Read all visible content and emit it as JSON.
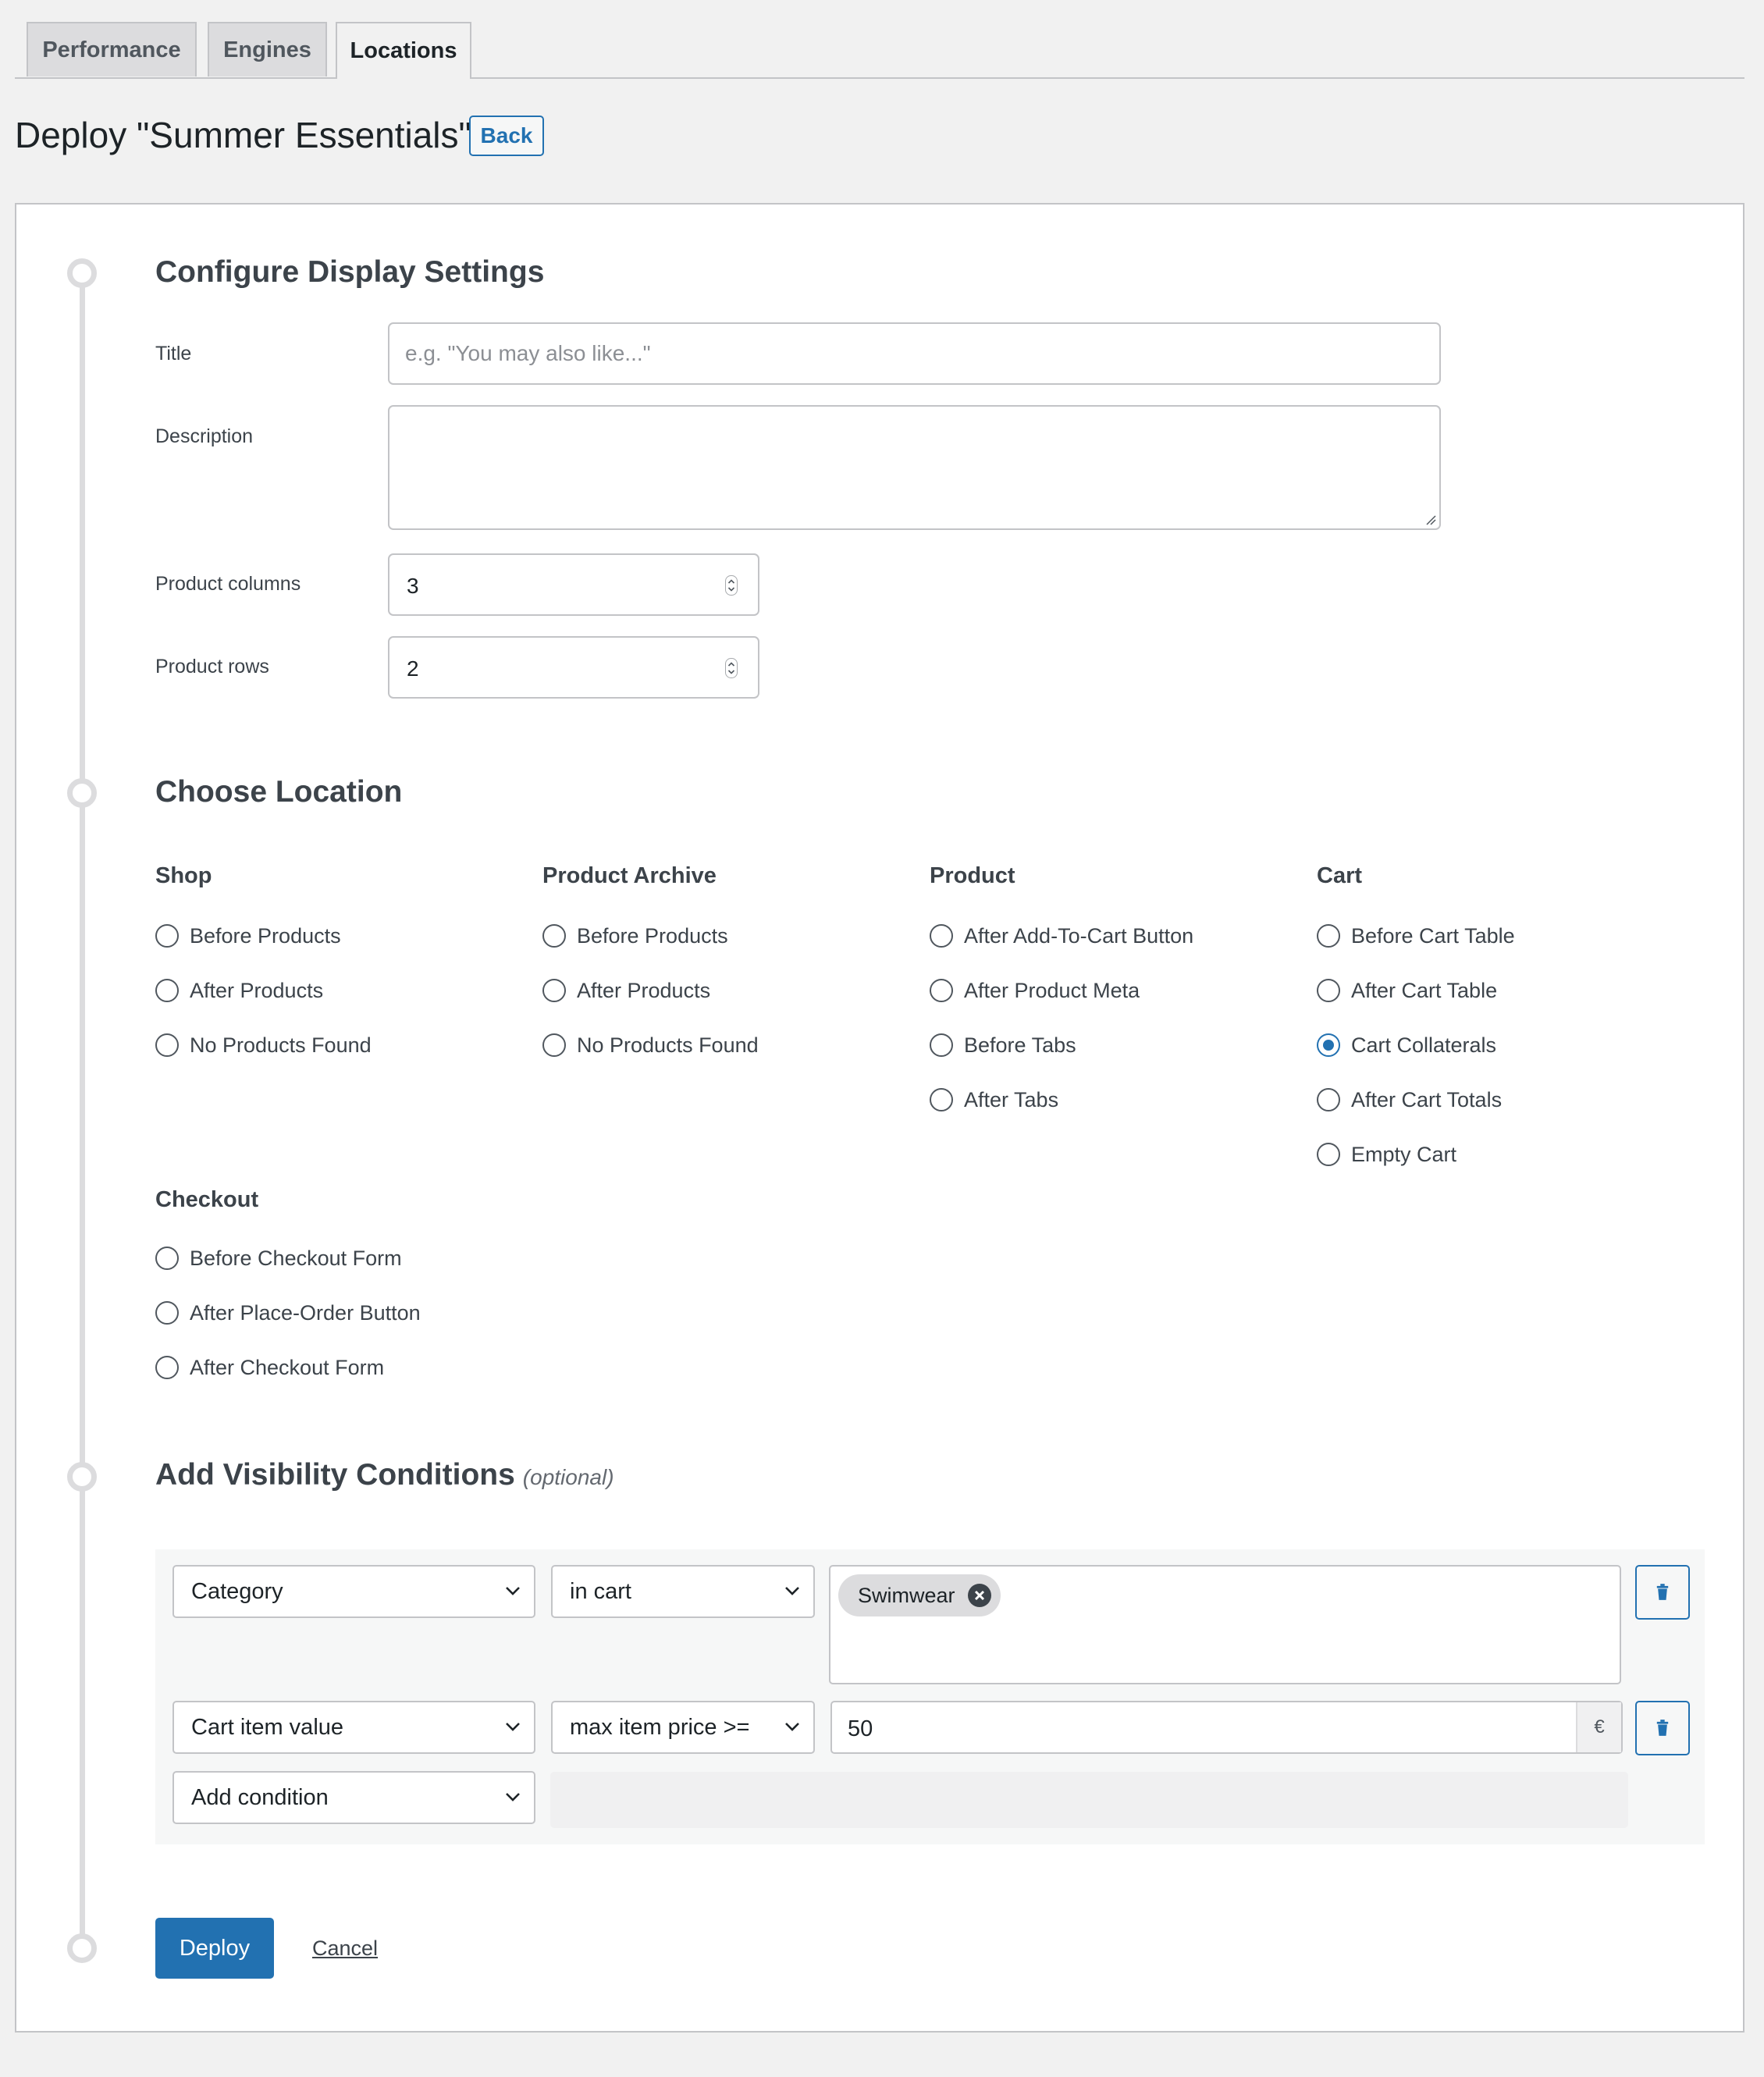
{
  "tabs": [
    {
      "label": "Performance"
    },
    {
      "label": "Engines"
    },
    {
      "label": "Locations"
    }
  ],
  "page": {
    "title": "Deploy \"Summer Essentials\"",
    "back_label": "Back"
  },
  "display_settings": {
    "heading": "Configure Display Settings",
    "title_label": "Title",
    "title_placeholder": "e.g. \"You may also like...\"",
    "title_value": "",
    "description_label": "Description",
    "description_value": "",
    "columns_label": "Product columns",
    "columns_value": "3",
    "rows_label": "Product rows",
    "rows_value": "2"
  },
  "location": {
    "heading": "Choose Location",
    "selected": "Cart Collaterals",
    "groups": [
      {
        "name": "Shop",
        "options": [
          "Before Products",
          "After Products",
          "No Products Found"
        ]
      },
      {
        "name": "Product Archive",
        "options": [
          "Before Products",
          "After Products",
          "No Products Found"
        ]
      },
      {
        "name": "Product",
        "options": [
          "After Add-To-Cart Button",
          "After Product Meta",
          "Before Tabs",
          "After Tabs"
        ]
      },
      {
        "name": "Cart",
        "options": [
          "Before Cart Table",
          "After Cart Table",
          "Cart Collaterals",
          "After Cart Totals",
          "Empty Cart"
        ]
      },
      {
        "name": "Checkout",
        "options": [
          "Before Checkout Form",
          "After Place-Order Button",
          "After Checkout Form"
        ]
      }
    ]
  },
  "visibility": {
    "heading": "Add Visibility Conditions",
    "optional": "(optional)",
    "conditions": [
      {
        "field": "Category",
        "operator": "in cart",
        "tags": [
          "Swimwear"
        ]
      },
      {
        "field": "Cart item value",
        "operator": "max item price >=",
        "value": "50",
        "currency": "€"
      }
    ],
    "add_label": "Add condition"
  },
  "actions": {
    "deploy": "Deploy",
    "cancel": "Cancel"
  },
  "colors": {
    "accent": "#2271b1",
    "background": "#f1f1f1",
    "border": "#c3c4c7"
  }
}
